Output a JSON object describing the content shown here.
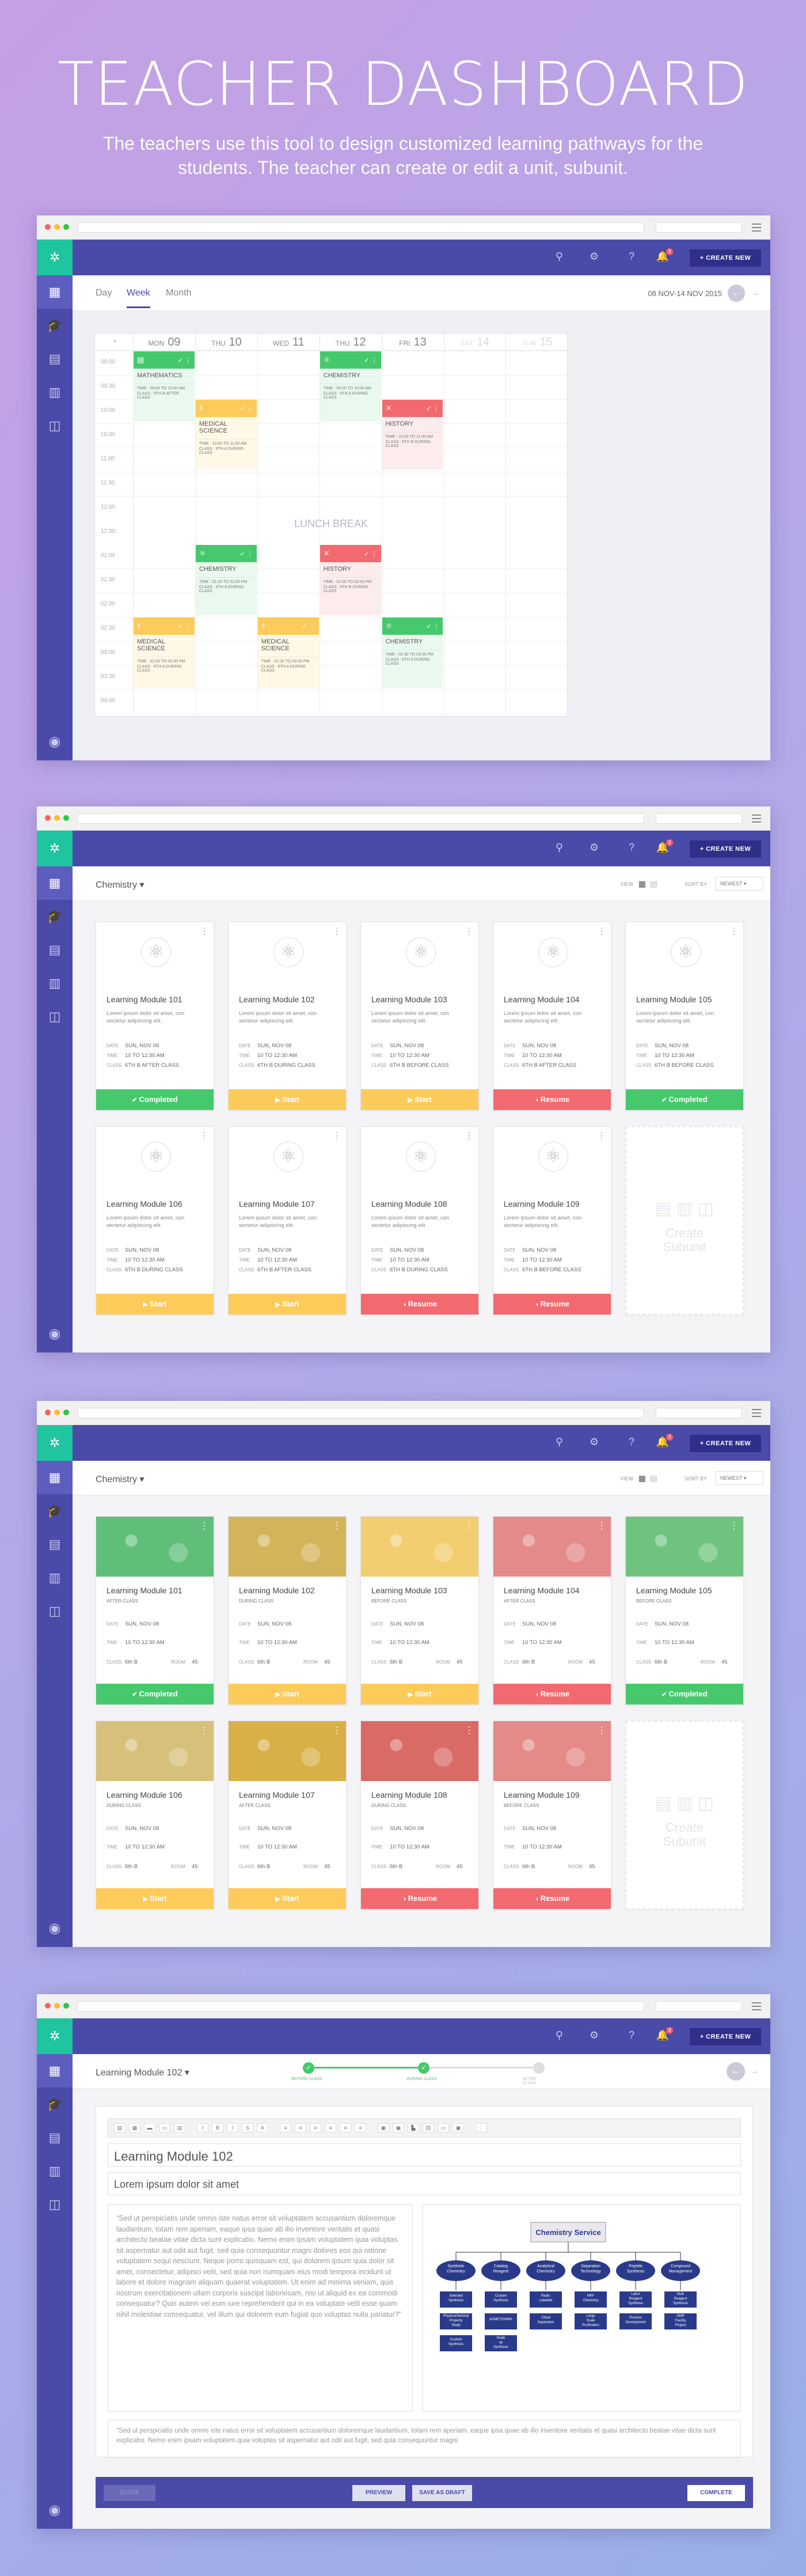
{
  "hero": {
    "title": "TEACHER DASHBOARD",
    "subtitle": "The teachers use this tool to design customized learning pathways for the students. The teacher can create or edit a unit, subunit."
  },
  "colors": {
    "sidebar": "#4a4aa8",
    "logo": "#1ec59e",
    "green": "#46c96c",
    "yellow": "#fdcb5a",
    "red": "#f26a6f"
  },
  "topbar": {
    "create_label": "+ CREATE NEW",
    "notif_count": "3"
  },
  "calendar": {
    "tabs": [
      "Day",
      "Week",
      "Month"
    ],
    "date_range": "08 NOV-14 NOV 2015",
    "days": [
      {
        "name": "MON",
        "num": "09"
      },
      {
        "name": "THU",
        "num": "10"
      },
      {
        "name": "WED",
        "num": "11"
      },
      {
        "name": "THU",
        "num": "12"
      },
      {
        "name": "FRI",
        "num": "13"
      },
      {
        "name": "SAT",
        "num": "14"
      },
      {
        "name": "SUN",
        "num": "15"
      }
    ],
    "times": [
      "09:00",
      "09:30",
      "10:00",
      "10:30",
      "11:00",
      "11:30",
      "12:00",
      "12:30",
      "01:00",
      "01:30",
      "02:00",
      "02:30",
      "03:00",
      "03:30",
      "04:00"
    ],
    "lunch": "LUNCH BREAK",
    "events": [
      {
        "title": "MATHEMATICS",
        "time": "TIME : 09:00 TO 10:00 AM",
        "class": "CLASS : 5TH B AFTER CLASS"
      },
      {
        "title": "CHEMISTRY",
        "time": "TIME : 09:00 TO 10:00 AM",
        "class": "CLASS : 6TH A DURING CLASS"
      },
      {
        "title": "MEDICAL SCIENCE",
        "time": "TIME : 10:00 TO 11:00 AM",
        "class": "CLASS : 6TH A DURING CLASS"
      },
      {
        "title": "HISTORY",
        "time": "TIME : 10:00 TO 11:00 AM",
        "class": "CLASS : 6TH B DURING CLASS"
      },
      {
        "title": "CHEMISTRY",
        "time": "TIME : 01:00 TO 02:00 PM",
        "class": "CLASS : 6TH A DURING CLASS"
      },
      {
        "title": "HISTORY",
        "time": "TIME : 01:00 TO 02:00 PM",
        "class": "CLASS : 6TH B DURING CLASS"
      },
      {
        "title": "MEDICAL SCIENCE",
        "time": "TIME : 02:30 TO 03:30 PM",
        "class": "CLASS : 6TH A DURING CLASS"
      },
      {
        "title": "MEDICAL SCIENCE",
        "time": "TIME : 02:30 TO 03:30 PM",
        "class": "CLASS : 6TH A DURING CLASS"
      },
      {
        "title": "CHEMISTRY",
        "time": "TIME : 02:30 TO 03:30 PM",
        "class": "CLASS : 6TH A DURING CLASS"
      }
    ]
  },
  "modules": {
    "subject": "Chemistry",
    "view_label": "VIEW",
    "sort_label": "SORT BY",
    "sort_value": "NEWEST",
    "desc": "Lorem ipsum dolor sit amet, con sectetur adipiscing elit.",
    "date_label": "DATE",
    "time_label": "TIME",
    "class_label": "CLASS",
    "room_label": "ROOM",
    "date_value": "SUN, NOV 08",
    "time_value": "10 TO 12:30 AM",
    "create_sub": "Create Subunit",
    "items": [
      {
        "title": "Learning Module 101",
        "class": "6TH B AFTER CLASS",
        "action": "Completed",
        "sub": "AFTER CLASS",
        "cls": "6th B",
        "room": "45"
      },
      {
        "title": "Learning Module 102",
        "class": "6TH B DURING CLASS",
        "action": "Start",
        "sub": "DURING CLASS",
        "cls": "6th B",
        "room": "45"
      },
      {
        "title": "Learning Module 103",
        "class": "6TH B BEFORE CLASS",
        "action": "Start",
        "sub": "BEFORE CLASS",
        "cls": "6th B",
        "room": "45"
      },
      {
        "title": "Learning Module 104",
        "class": "6TH B AFTER CLASS",
        "action": "Resume",
        "sub": "AFTER CLASS",
        "cls": "6th B",
        "room": "45"
      },
      {
        "title": "Learning Module 105",
        "class": "6TH B BEFORE CLASS",
        "action": "Completed",
        "sub": "BEFORE CLASS",
        "cls": "6th B",
        "room": "45"
      },
      {
        "title": "Learning Module 106",
        "class": "6TH B DURING CLASS",
        "action": "Start",
        "sub": "DURING CLASS",
        "cls": "6th B",
        "room": "45"
      },
      {
        "title": "Learning Module 107",
        "class": "6TH B AFTER CLASS",
        "action": "Start",
        "sub": "AFTER CLASS",
        "cls": "6th B",
        "room": "45"
      },
      {
        "title": "Learning Module 108",
        "class": "6TH B DURING CLASS",
        "action": "Resume",
        "sub": "DURING CLASS",
        "cls": "6th B",
        "room": "45"
      },
      {
        "title": "Learning Module 109",
        "class": "6TH B BEFORE CLASS",
        "action": "Resume",
        "sub": "BEFORE CLASS",
        "cls": "6th B",
        "room": "45"
      }
    ]
  },
  "editor": {
    "module": "Learning Module 102",
    "steps": [
      "BEFORE CLASS",
      "DURING CLASS",
      "AFTER CLASS"
    ],
    "title": "Learning Module 102",
    "subtitle": "Lorem ipsum dolor sit amet",
    "para": "\"Sed ut perspiciatis unde omnis iste natus error sit voluptatem accusantium doloremque laudantium, totam rem aperiam, eaque ipsa quae ab illo inventore veritatis et quasi architecto beatae vitae dicta sunt explicabo. Nemo enim ipsam voluptatem quia voluptas sit aspernatur aut odit aut fugit, sed quia consequuntur magni dolores eos qui ratione voluptatem sequi nesciunt. Neque porro quisquam est, qui dolorem ipsum quia dolor sit amet, consectetur, adipisci velit, sed quia non numquam eius modi tempora incidunt ut labore et dolore magnam aliquam quaerat voluptatem. Ut enim ad minima veniam, quis nostrum exercitationem ullam corporis suscipit laboriosam, nisi ut aliquid ex ea commodi consequatur? Quis autem vel eum iure reprehenderit qui in ea voluptate velit esse quam nihil molestiae consequatur, vel illum qui dolorem eum fugiat quo voluptas nulla pariatur?\"",
    "para2": "\"Sed ut perspiciatis unde omnis iste natus error sit voluptatem accusantium doloremque laudantium, totam rem aperiam, eaque ipsa quae ab illo inventore veritatis et quasi architecto beatae vitae dicta sunt explicabo. Nemo enim ipsam voluptatem quia voluptas sit aspernatur aut odit aut fugit, sed quia consequuntur magni",
    "diagram_title": "Chemistry Service",
    "diagram_nodes": [
      "Synthetic Chemistry",
      "Catalog Reagent",
      "Analytical Chemistry",
      "Separation Technology",
      "Peptide Synthesis",
      "Compound Management"
    ],
    "diagram_leaves": [
      "Selected Synthesis",
      "Custom Synthesis",
      "Radio Labelled",
      "NRF Chemistry",
      "Labor Reagent Synthesis",
      "Bulk Reagent Synthesis",
      "Physicochemical Property Study",
      "ADMET/DMPK",
      "Chiral Separation",
      "Large Scale Purification",
      "Process Development",
      "GMP Facility Project",
      "Custom Synthesis",
      "Scale up Synthesis"
    ],
    "back": "CLOSE",
    "preview": "PREVIEW",
    "draft": "SAVE AS DRAFT",
    "complete": "COMPLETE"
  }
}
